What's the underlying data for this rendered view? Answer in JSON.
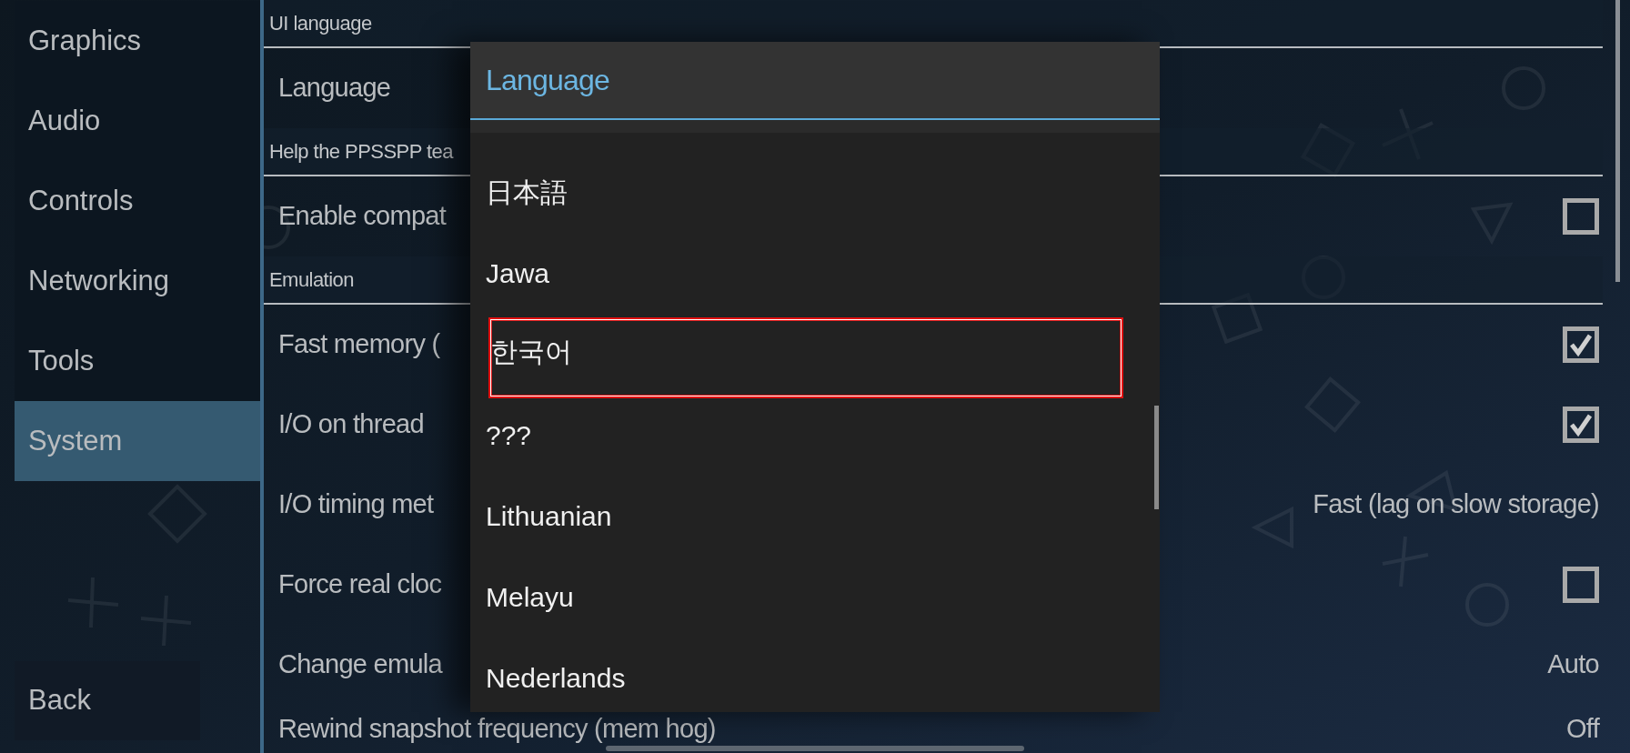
{
  "sidebar": {
    "items": [
      {
        "label": "Graphics",
        "selected": false
      },
      {
        "label": "Audio",
        "selected": false
      },
      {
        "label": "Controls",
        "selected": false
      },
      {
        "label": "Networking",
        "selected": false
      },
      {
        "label": "Tools",
        "selected": false
      },
      {
        "label": "System",
        "selected": true
      }
    ],
    "back_button": "Back"
  },
  "settings": {
    "sections": [
      {
        "header": "UI language",
        "rows": [
          {
            "kind": "plain",
            "label": "Language"
          }
        ]
      },
      {
        "header": "Help the PPSSPP tea",
        "rows": [
          {
            "kind": "checkbox",
            "label": "Enable compat",
            "checked": false
          }
        ]
      },
      {
        "header": "Emulation",
        "rows": [
          {
            "kind": "checkbox",
            "label": "Fast memory (",
            "checked": true
          },
          {
            "kind": "checkbox",
            "label": "I/O on thread",
            "checked": true
          },
          {
            "kind": "value",
            "label": "I/O timing met",
            "value": "Fast (lag on slow storage)"
          },
          {
            "kind": "checkbox",
            "label": "Force real cloc",
            "checked": false
          },
          {
            "kind": "value",
            "label": "Change emula",
            "value": "Auto"
          },
          {
            "kind": "value",
            "label": "Rewind snapshot frequency (mem hog)",
            "value": "Off"
          }
        ]
      }
    ]
  },
  "dialog": {
    "title": "Language",
    "items": [
      {
        "label": "日本語",
        "selected": false
      },
      {
        "label": "Jawa",
        "selected": false
      },
      {
        "label": "한국어",
        "selected": true
      },
      {
        "label": "???",
        "selected": false
      },
      {
        "label": "Lithuanian",
        "selected": false
      },
      {
        "label": "Melayu",
        "selected": false
      },
      {
        "label": "Nederlands",
        "selected": false
      }
    ]
  }
}
